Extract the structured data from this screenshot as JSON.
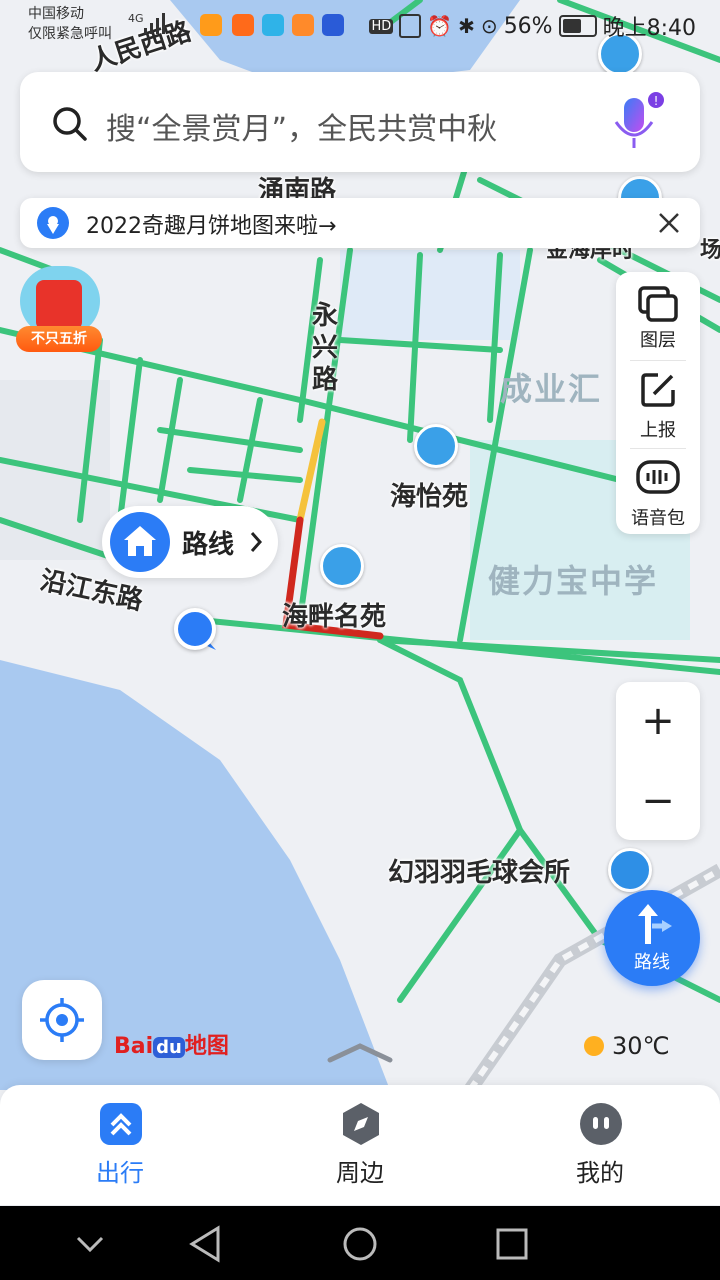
{
  "status_bar": {
    "carrier": "中国移动",
    "emergency": "仅限紧急呼叫",
    "network": "4G",
    "hd": "HD",
    "battery": "56%",
    "time": "晚上8:40"
  },
  "search": {
    "placeholder": "搜“全景赏月”，全民共赏中秋"
  },
  "notice": {
    "text": "2022奇趣月饼地图来啦→"
  },
  "promo": {
    "tag": "不只五折"
  },
  "tools": {
    "layers_label": "图层",
    "report_label": "上报",
    "voice_label": "语音包"
  },
  "home_popup": {
    "label": "路线"
  },
  "map_labels": {
    "road_top": "人民西路",
    "road_yongxing": "永兴路",
    "road_yongnan": "涌南路",
    "road_yanjiang": "沿江东路",
    "area_chengye": "成业汇",
    "poi_haiyi": "海怡苑",
    "poi_haipan": "海畔名苑",
    "school": "健力宝中学",
    "poi_badminton": "幻羽羽毛球会所",
    "top_right_1": "金海岸时",
    "top_right_2": "场"
  },
  "route_button": {
    "label": "路线"
  },
  "brand": {
    "bai": "Bai",
    "du": "du",
    "suffix": "地图"
  },
  "weather": {
    "temp": "30℃"
  },
  "bottom_nav": {
    "items": [
      {
        "label": "出行",
        "active": true
      },
      {
        "label": "周边",
        "active": false
      },
      {
        "label": "我的",
        "active": false
      }
    ]
  },
  "colors": {
    "road_green": "#3cc47c",
    "route_blue": "#2b7cf6",
    "water": "#a9c9f0",
    "traffic_red": "#d0281e",
    "traffic_yellow": "#f5c23c"
  }
}
